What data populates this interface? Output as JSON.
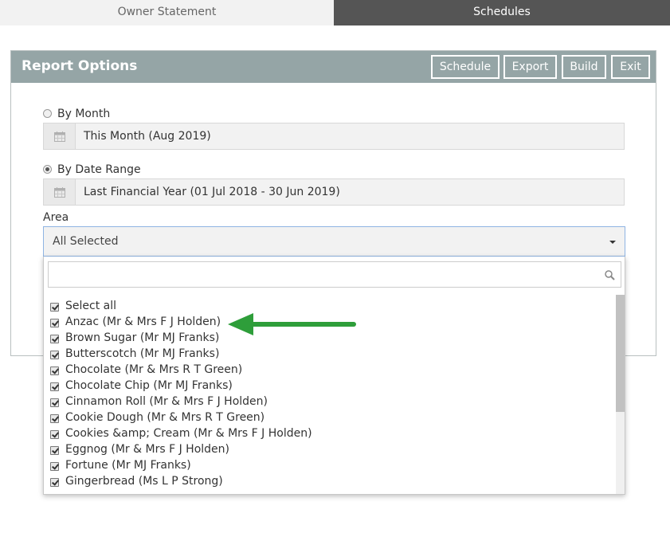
{
  "tabs": [
    {
      "label": "Owner Statement",
      "active": false
    },
    {
      "label": "Schedules",
      "active": true
    }
  ],
  "panel": {
    "title": "Report Options",
    "buttons": [
      "Schedule",
      "Export",
      "Build",
      "Exit"
    ]
  },
  "by_month": {
    "label": "By Month",
    "selected": false,
    "value": "This Month (Aug 2019)"
  },
  "by_date_range": {
    "label": "By Date Range",
    "selected": true,
    "value": "Last Financial Year (01 Jul 2018 - 30 Jun 2019)"
  },
  "area": {
    "label": "Area",
    "selected_value": "All Selected",
    "search_placeholder": "",
    "options": [
      {
        "label": "Select all",
        "checked": true
      },
      {
        "label": "Anzac (Mr & Mrs F J Holden)",
        "checked": true
      },
      {
        "label": "Brown Sugar (Mr MJ Franks)",
        "checked": true
      },
      {
        "label": "Butterscotch (Mr MJ Franks)",
        "checked": true
      },
      {
        "label": "Chocolate (Mr & Mrs R T Green)",
        "checked": true
      },
      {
        "label": "Chocolate Chip (Mr MJ Franks)",
        "checked": true
      },
      {
        "label": "Cinnamon Roll (Mr & Mrs F J Holden)",
        "checked": true
      },
      {
        "label": "Cookie Dough (Mr & Mrs R T Green)",
        "checked": true
      },
      {
        "label": "Cookies &amp; Cream (Mr & Mrs F J Holden)",
        "checked": true
      },
      {
        "label": "Eggnog (Mr & Mrs F J Holden)",
        "checked": true
      },
      {
        "label": "Fortune (Mr MJ Franks)",
        "checked": true
      },
      {
        "label": "Gingerbread (Ms L P Strong)",
        "checked": true
      },
      {
        "label": "",
        "checked": true
      }
    ]
  },
  "colors": {
    "header_bg": "#95a5a6",
    "active_tab_bg": "#555555",
    "arrow": "#2e9e3a"
  }
}
